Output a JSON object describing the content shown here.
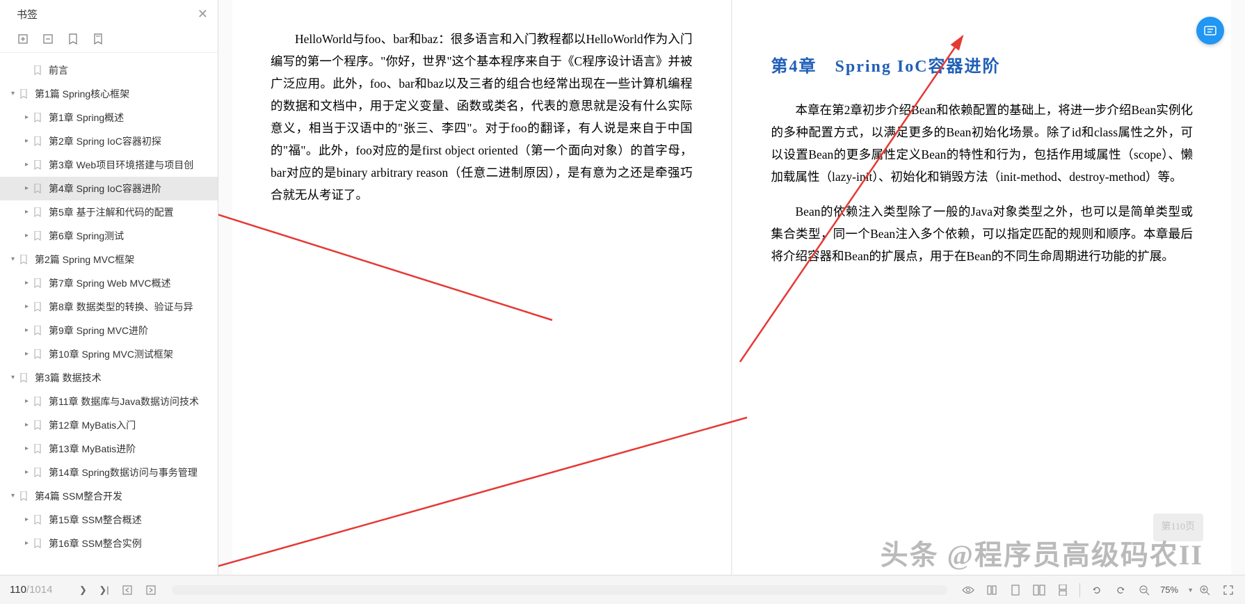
{
  "sidebar": {
    "title": "书签",
    "items": [
      {
        "level": 2,
        "arrow": "",
        "label": "前言"
      },
      {
        "level": 1,
        "arrow": "▾",
        "label": "第1篇 Spring核心框架"
      },
      {
        "level": 2,
        "arrow": "▸",
        "label": "第1章 Spring概述"
      },
      {
        "level": 2,
        "arrow": "▸",
        "label": "第2章 Spring IoC容器初探"
      },
      {
        "level": 2,
        "arrow": "▸",
        "label": "第3章 Web项目环境搭建与项目创"
      },
      {
        "level": 2,
        "arrow": "▸",
        "label": "第4章 Spring IoC容器进阶",
        "selected": true
      },
      {
        "level": 2,
        "arrow": "▸",
        "label": "第5章 基于注解和代码的配置"
      },
      {
        "level": 2,
        "arrow": "▸",
        "label": "第6章 Spring测试"
      },
      {
        "level": 1,
        "arrow": "▾",
        "label": "第2篇 Spring MVC框架"
      },
      {
        "level": 2,
        "arrow": "▸",
        "label": "第7章 Spring Web MVC概述"
      },
      {
        "level": 2,
        "arrow": "▸",
        "label": "第8章 数据类型的转换、验证与异"
      },
      {
        "level": 2,
        "arrow": "▸",
        "label": "第9章 Spring MVC进阶"
      },
      {
        "level": 2,
        "arrow": "▸",
        "label": "第10章 Spring MVC测试框架"
      },
      {
        "level": 1,
        "arrow": "▾",
        "label": "第3篇 数据技术"
      },
      {
        "level": 2,
        "arrow": "▸",
        "label": "第11章 数据库与Java数据访问技术"
      },
      {
        "level": 2,
        "arrow": "▸",
        "label": "第12章 MyBatis入门"
      },
      {
        "level": 2,
        "arrow": "▸",
        "label": "第13章 MyBatis进阶"
      },
      {
        "level": 2,
        "arrow": "▸",
        "label": "第14章 Spring数据访问与事务管理"
      },
      {
        "level": 1,
        "arrow": "▾",
        "label": "第4篇 SSM整合开发"
      },
      {
        "level": 2,
        "arrow": "▸",
        "label": "第15章 SSM整合概述"
      },
      {
        "level": 2,
        "arrow": "▸",
        "label": "第16章 SSM整合实例"
      }
    ]
  },
  "leftPage": {
    "para1": "HelloWorld与foo、bar和baz：很多语言和入门教程都以HelloWorld作为入门编写的第一个程序。\"你好，世界\"这个基本程序来自于《C程序设计语言》并被广泛应用。此外，foo、bar和baz以及三者的组合也经常出现在一些计算机编程的数据和文档中，用于定义变量、函数或类名，代表的意思就是没有什么实际意义，相当于汉语中的\"张三、李四\"。对于foo的翻译，有人说是来自于中国的\"福\"。此外，foo对应的是first object oriented（第一个面向对象）的首字母，bar对应的是binary arbitrary reason（任意二进制原因），是有意为之还是牵强巧合就无从考证了。"
  },
  "rightPage": {
    "title": "第4章　Spring IoC容器进阶",
    "para1": "本章在第2章初步介绍Bean和依赖配置的基础上，将进一步介绍Bean实例化的多种配置方式，以满足更多的Bean初始化场景。除了id和class属性之外，可以设置Bean的更多属性定义Bean的特性和行为，包括作用域属性（scope）、懒加载属性（lazy-init）、初始化和销毁方法（init-method、destroy-method）等。",
    "para2": "Bean的依赖注入类型除了一般的Java对象类型之外，也可以是简单类型或集合类型，同一个Bean注入多个依赖，可以指定匹配的规则和顺序。本章最后将介绍容器和Bean的扩展点，用于在Bean的不同生命周期进行功能的扩展。",
    "badge": "第110页"
  },
  "watermark": "头条 @程序员高级码农II",
  "bottom": {
    "currentPage": "110",
    "totalPages": "/1014",
    "zoom": "75%"
  }
}
